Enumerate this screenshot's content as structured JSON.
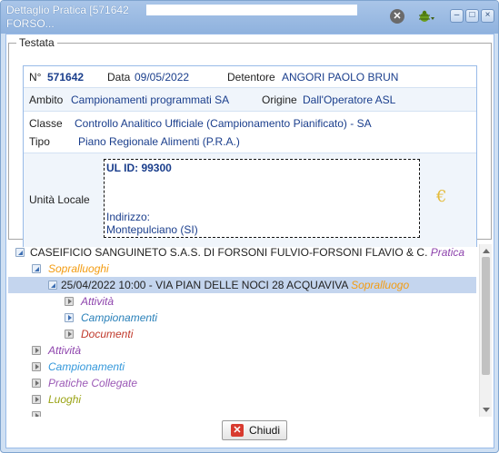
{
  "window": {
    "title_line1": "Dettaglio Pratica [571642",
    "title_line2": "FORSO..."
  },
  "testata": {
    "legend": "Testata",
    "numero_label": "N°",
    "numero_value": "571642",
    "data_label": "Data",
    "data_value": "09/05/2022",
    "detentore_label": "Detentore",
    "detentore_value": "ANGORI PAOLO BRUN",
    "ambito_label": "Ambito",
    "ambito_value": "Campionamenti programmati SA",
    "origine_label": "Origine",
    "origine_value": "Dall'Operatore ASL",
    "classe_label": "Classe",
    "classe_value": "Controllo Analitico Ufficiale (Campionamento Pianificato) - SA",
    "tipo_label": "Tipo",
    "tipo_value": "Piano Regionale Alimenti (P.R.A.)",
    "unita_label": "Unità Locale",
    "ul_id": "UL ID: 99300",
    "indirizzo_label": "Indirizzo:",
    "indirizzo_value": "Montepulciano (SI)",
    "euro_icon": "€"
  },
  "tree": {
    "items": [
      {
        "text": "CASEIFICIO SANGUINETO S.A.S. DI FORSONI FULVIO-FORSONI FLAVIO & C.",
        "suffix": "Pratica"
      },
      {
        "text": "Sopralluoghi"
      },
      {
        "text": "25/04/2022 10:00 - VIA PIAN DELLE NOCI 28 ACQUAVIVA",
        "suffix": "Sopralluogo"
      },
      {
        "text": "Attività"
      },
      {
        "text": "Campionamenti"
      },
      {
        "text": "Documenti"
      },
      {
        "text": "Attività"
      },
      {
        "text": "Campionamenti"
      },
      {
        "text": "Pratiche Collegate"
      },
      {
        "text": "Luoghi"
      }
    ]
  },
  "footer": {
    "close_label": "Chiudi"
  },
  "colors": {
    "titlebar": "#8fb2de",
    "selected_row": "#c4d5ee",
    "pratica": "#8e44ad",
    "sopralluogo": "#f39c12"
  }
}
